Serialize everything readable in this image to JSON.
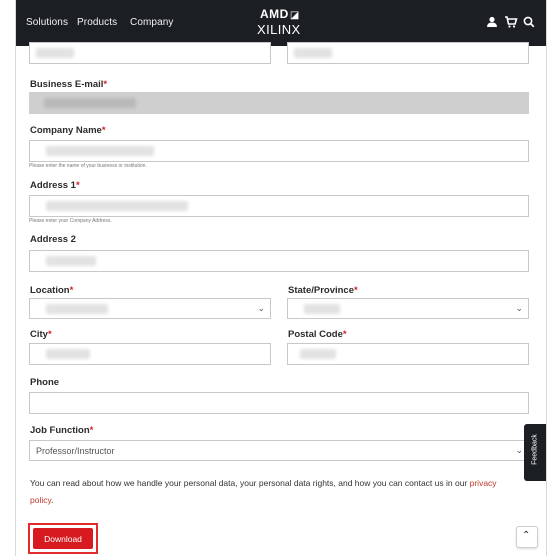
{
  "nav": {
    "links": [
      "Solutions",
      "Products",
      "Company"
    ],
    "logo_top": "AMD",
    "logo_bottom": "XILINX"
  },
  "form": {
    "business_email_label": "Business E-mail",
    "company_name_label": "Company Name",
    "company_name_hint": "Please enter the name of your business or institution.",
    "address1_label": "Address 1",
    "address1_hint": "Please enter your Company Address.",
    "address2_label": "Address 2",
    "location_label": "Location",
    "state_label": "State/Province",
    "city_label": "City",
    "postal_label": "Postal Code",
    "phone_label": "Phone",
    "job_function_label": "Job Function",
    "job_function_value": "Professor/Instructor",
    "required_mark": "*"
  },
  "privacy": {
    "text": "You can read about how we handle your personal data, your personal data rights, and how you can contact us in our ",
    "link": "privacy policy",
    "end": "."
  },
  "download_label": "Download",
  "feedback_label": "Feedback",
  "scroll_top_icon": "chevron-up-icon"
}
